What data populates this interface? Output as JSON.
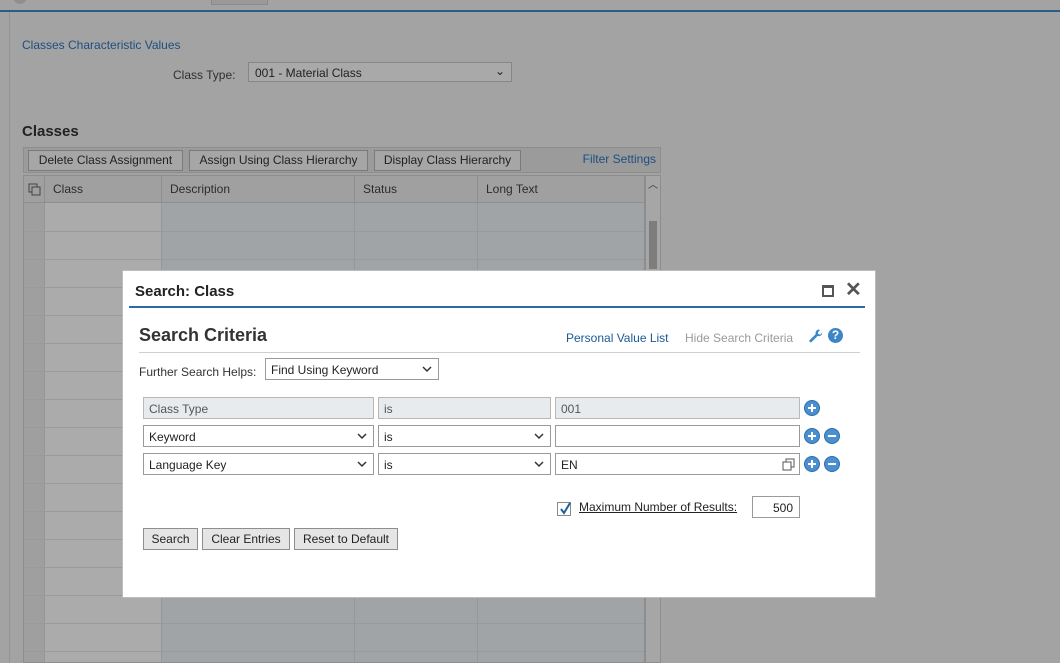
{
  "background": {
    "link_title": "Classes Characteristic Values",
    "class_type_label": "Class Type:",
    "class_type_value": "001 - Material Class",
    "section_title": "Classes",
    "toolbar": {
      "delete": "Delete Class Assignment",
      "assign": "Assign Using Class Hierarchy",
      "display": "Display Class Hierarchy",
      "filter": "Filter Settings"
    },
    "table": {
      "columns": [
        "Class",
        "Description",
        "Status",
        "Long Text"
      ]
    }
  },
  "dialog": {
    "title": "Search: Class",
    "section_title": "Search Criteria",
    "personal_value_list": "Personal Value List",
    "hide_search_criteria": "Hide Search Criteria",
    "further_label": "Further Search Helps:",
    "further_value": "Find Using Keyword",
    "rows": [
      {
        "field": "Class Type",
        "op": "is",
        "value": "001"
      },
      {
        "field": "Keyword",
        "op": "is",
        "value": ""
      },
      {
        "field": "Language Key",
        "op": "is",
        "value": "EN"
      }
    ],
    "max_results_label": "Maximum Number of Results:",
    "max_results_value": "500",
    "max_results_checked": true,
    "buttons": {
      "search": "Search",
      "clear": "Clear Entries",
      "reset": "Reset to Default"
    }
  },
  "colors": {
    "accent": "#2a6aa8",
    "link": "#1a5a96",
    "overlay": "#a3a3a3"
  }
}
